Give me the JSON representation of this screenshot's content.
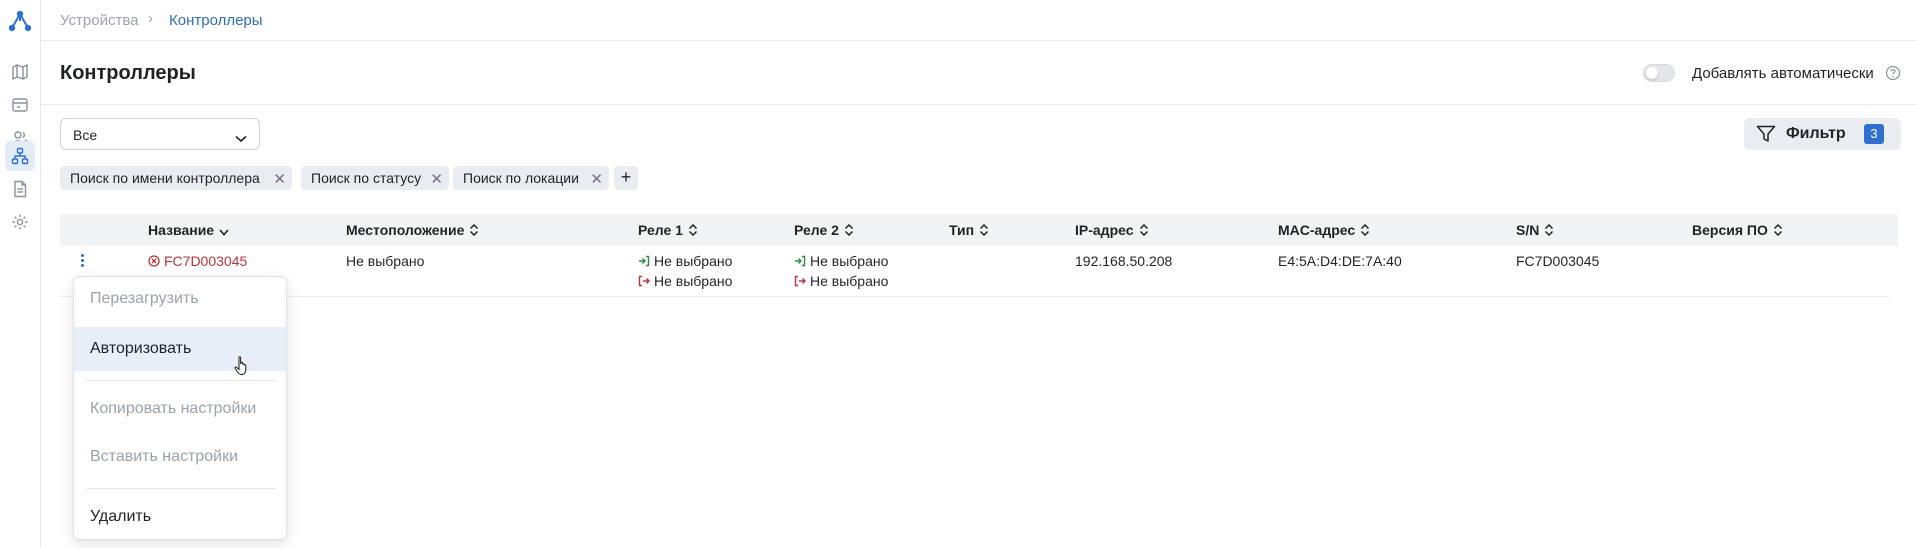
{
  "breadcrumb": {
    "parent": "Устройства",
    "separator": "›",
    "current": "Контроллеры"
  },
  "header": {
    "title": "Контроллеры",
    "auto_add_label": "Добавлять автоматически",
    "auto_add_enabled": false
  },
  "status_select": {
    "value": "Все"
  },
  "filter_button": {
    "label": "Фильтр",
    "count": "3"
  },
  "chips": [
    {
      "label": "Поиск по имени контроллера"
    },
    {
      "label": "Поиск по статусу"
    },
    {
      "label": "Поиск по локации"
    }
  ],
  "table": {
    "columns": [
      "Название",
      "Местоположение",
      "Реле 1",
      "Реле 2",
      "Тип",
      "IP-адрес",
      "MAC-адрес",
      "S/N",
      "Версия ПО"
    ],
    "rows": [
      {
        "name": "FC7D003045",
        "status_color": "#b8333c",
        "location": "Не выбрано",
        "relay1_in": "Не выбрано",
        "relay1_out": "Не выбрано",
        "relay2_in": "Не выбрано",
        "relay2_out": "Не выбрано",
        "type": "",
        "ip": "192.168.50.208",
        "mac": "E4:5A:D4:DE:7A:40",
        "sn": "FC7D003045",
        "firmware": ""
      }
    ]
  },
  "context_menu": {
    "items": [
      {
        "label": "Перезагрузить",
        "state": "disabled"
      },
      {
        "label": "Авторизовать",
        "state": "hover"
      },
      {
        "label": "Копировать настройки",
        "state": "disabled"
      },
      {
        "label": "Вставить настройки",
        "state": "disabled"
      },
      {
        "label": "Удалить",
        "state": "enabled"
      }
    ]
  },
  "colors": {
    "accent": "#2f6fd0",
    "error": "#b8333c",
    "relay_in": "#2e8a3e",
    "relay_out": "#b8333c"
  }
}
